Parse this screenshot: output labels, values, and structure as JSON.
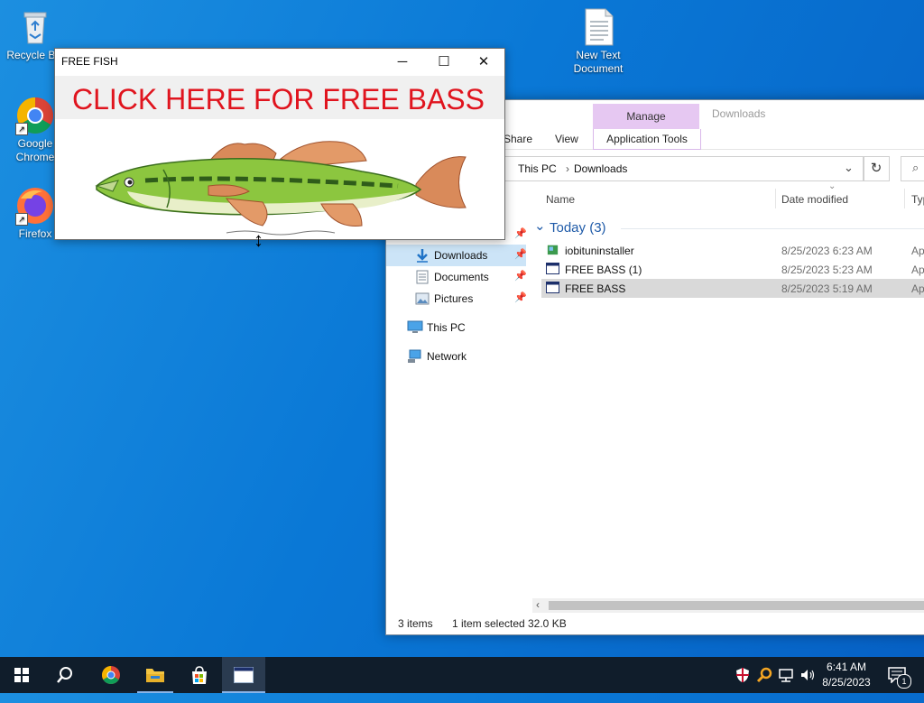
{
  "desktop": {
    "recycle_bin_label": "Recycle Bin",
    "chrome_label": "Google Chrome",
    "firefox_label": "Firefox",
    "new_text_label": "New Text Document"
  },
  "fish_window": {
    "title": "FREE FISH",
    "banner": "CLICK HERE FOR FREE BASS",
    "minimize": "─",
    "maximize": "☐",
    "close": "✕"
  },
  "explorer": {
    "manage_tab": "Manage",
    "window_title": "Downloads",
    "tab_share": "Share",
    "tab_view": "View",
    "tab_app_tools": "Application Tools",
    "breadcrumb": [
      "This PC",
      "Downloads"
    ],
    "refresh": "↻",
    "nav": [
      {
        "label": "Downloads",
        "icon": "download-icon"
      },
      {
        "label": "Documents",
        "icon": "documents-icon"
      },
      {
        "label": "Pictures",
        "icon": "pictures-icon"
      },
      {
        "label": "This PC",
        "icon": "computer-icon"
      },
      {
        "label": "Network",
        "icon": "network-icon"
      }
    ],
    "columns": {
      "name": "Name",
      "date": "Date modified",
      "type": "Typ"
    },
    "group": "Today (3)",
    "files": [
      {
        "name": "iobituninstaller",
        "date": "8/25/2023 6:23 AM",
        "type": "Ap"
      },
      {
        "name": "FREE BASS (1)",
        "date": "8/25/2023 5:23 AM",
        "type": "Ap"
      },
      {
        "name": "FREE BASS",
        "date": "8/25/2023 5:19 AM",
        "type": "Ap"
      }
    ],
    "status": {
      "items": "3 items",
      "selected": "1 item selected",
      "size": "32.0 KB"
    }
  },
  "taskbar": {
    "time": "6:41 AM",
    "date": "8/25/2023",
    "notif_count": "1"
  },
  "colors": {
    "banner_text": "#e0141e",
    "manage_tab": "#e6c8f2",
    "taskbar": "#101d2b"
  }
}
